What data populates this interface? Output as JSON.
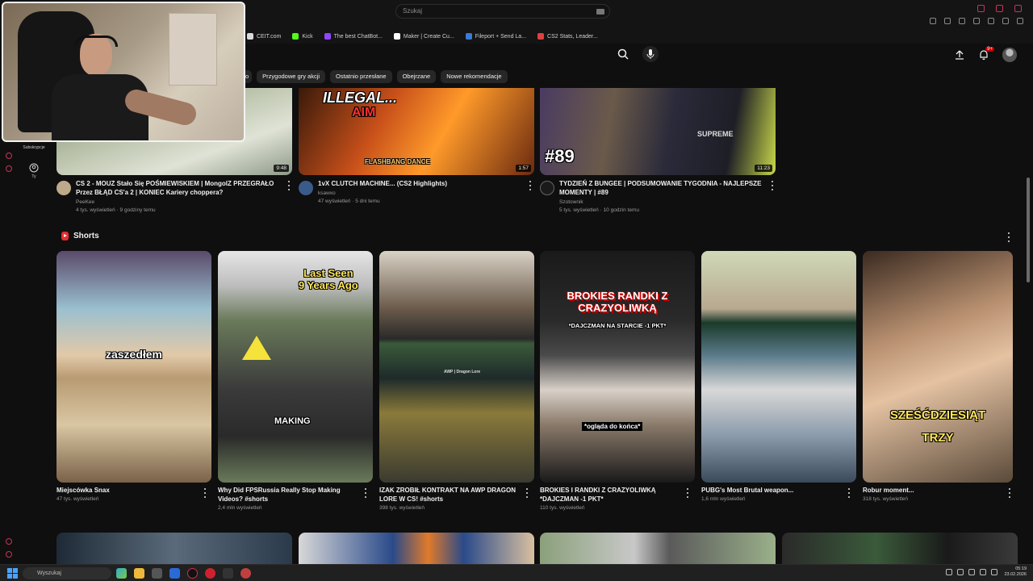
{
  "browser": {
    "bookmarks": [
      {
        "label": "CEIT.com",
        "color": "#d9d9d9"
      },
      {
        "label": "Kick",
        "color": "#53fc18"
      },
      {
        "label": "The best ChatBot...",
        "color": "#9146ff"
      },
      {
        "label": "Maker | Create Cu...",
        "color": "#ffffff"
      },
      {
        "label": "Fileport + Send La...",
        "color": "#3a7bd5"
      },
      {
        "label": "CS2 Stats, Leader...",
        "color": "#e04040"
      }
    ]
  },
  "header": {
    "search_placeholder": "Szukaj",
    "notif_badge": "9+"
  },
  "chips": [
    "o",
    "Przygodowe gry akcji",
    "Ostatnio przesłane",
    "Obejrzane",
    "Nowe rekomendacje"
  ],
  "sidebar": {
    "subs_label": "Subskrypcje",
    "you_label": "Ty"
  },
  "videos": [
    {
      "title": "CS 2 - MOUZ Stało Się POŚMIEWISKIEM | MongolZ PRZEGRAŁO Przez BŁĄD CS'a 2 | KONIEC Kariery choppera?",
      "channel": "PeeKee",
      "stats": "4 tys. wyświetleń · 9 godziny temu",
      "duration": "9:48"
    },
    {
      "title": "1vX CLUTCH MACHINE... (CS2 Highlights)",
      "channel": "ksawxo",
      "stats": "47 wyświetleń · 5 dni temu",
      "duration": "1:57",
      "overlay_top": "ILLEGAL...",
      "overlay_mid": "AIM",
      "overlay_bottom": "FLASHBANG DANCE"
    },
    {
      "title": "TYDZIEŃ Z BUNGEE | PODSUMOWANIE TYGODNIA - NAJLEPSZE MOMENTY | #89",
      "channel": "Szotownik",
      "stats": "5 tys. wyświetleń · 10 godzin temu",
      "duration": "11:23",
      "overlay": "#89",
      "shirt": "SUPREME"
    }
  ],
  "shorts": {
    "heading": "Shorts",
    "items": [
      {
        "title": "Miejscówka Snax",
        "stats": "47 tys. wyświetleń",
        "overlay": "zaszedłem"
      },
      {
        "title": "Why Did FPSRussia Really Stop Making Videos? #shorts",
        "stats": "2,4 mln wyświetleń",
        "overlay_top": "Last Seen\n9 Years Ago",
        "overlay_bottom": "MAKING"
      },
      {
        "title": "IZAK ZROBIŁ KONTRAKT NA AWP DRAGON LORE W CS! #shorts",
        "stats": "398 tys. wyświetleń",
        "overlay": "AWP | Dragon Lore"
      },
      {
        "title": "BROKIES I RANDKI Z CRAZYOLIWKĄ *DAJCZMAN -1 PKT*",
        "stats": "110 tys. wyświetleń",
        "overlay_top": "BROKIES RANDKI Z\nCRAZYOLIWKĄ",
        "overlay_sub": "*DAJCZMAN NA STARCIE -1 PKT*",
        "overlay_bottom": "*ogląda do końca*"
      },
      {
        "title": "PUBG's Most Brutal weapon...",
        "stats": "1,6 mln wyświetleń"
      },
      {
        "title": "Robur moment...",
        "stats": "318 tys. wyświetleń",
        "overlay": "SZEŚĆDZIESIĄT\nTRZY"
      }
    ]
  },
  "taskbar": {
    "search_placeholder": "Wyszukaj",
    "time": "05:19",
    "date": "23.02.2026"
  }
}
